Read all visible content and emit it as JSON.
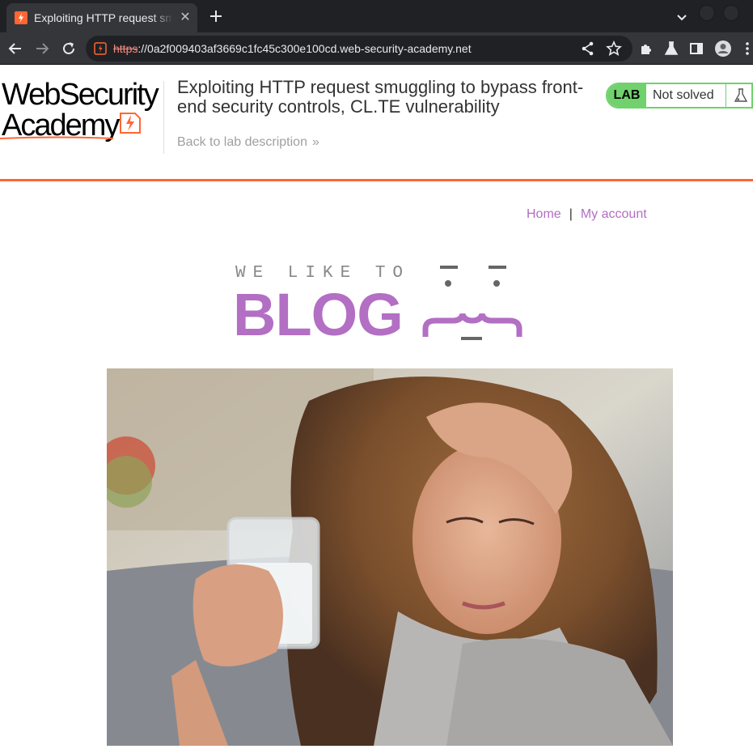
{
  "browser": {
    "tab_title": "Exploiting HTTP request smuggling to bypass front-end security controls, CL.TE vulnerability",
    "tab_close": "✕",
    "url_scheme": "https",
    "url_rest": "://0a2f009403af3669c1fc45c300e100cd.web-security-academy.net",
    "colors": {
      "tabbar": "#202124",
      "toolbar": "#35363a",
      "favicon": "#ff6633"
    }
  },
  "header": {
    "logo_line1": "WebSecurity",
    "logo_line2": "Academy",
    "lab_title": "Exploiting HTTP request smuggling to bypass front-end security controls, CL.TE vulnerability",
    "back_link": "Back to lab description",
    "back_chevrons": "»",
    "status_badge": "LAB",
    "status_text": "Not solved",
    "colors": {
      "accent": "#ff6633",
      "status": "#70d16d"
    }
  },
  "nav": {
    "home": "Home",
    "separator": "|",
    "my_account": "My account",
    "link_color": "#b26fc3"
  },
  "banner": {
    "tagline": "WE LIKE TO",
    "word": "BLOG"
  },
  "hero": {
    "icon": "blog-post-photo"
  }
}
